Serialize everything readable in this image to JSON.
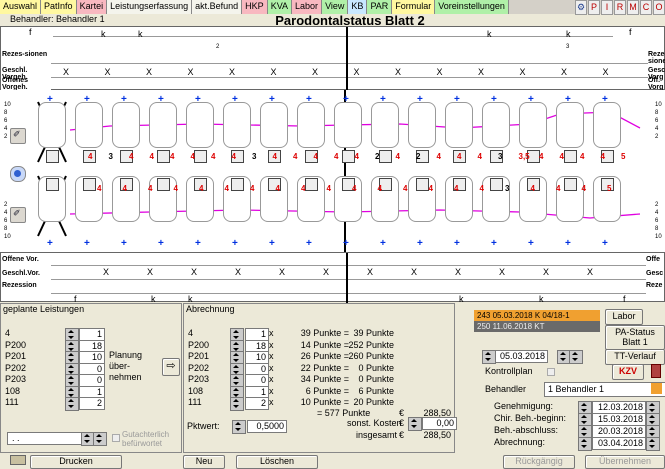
{
  "menu": {
    "tabs": [
      {
        "label": "Auswahl",
        "style": "cy"
      },
      {
        "label": "PatInfo",
        "style": "cy"
      },
      {
        "label": "Kartei",
        "style": "pk"
      },
      {
        "label": "Leistungserfassung",
        "style": "wh"
      },
      {
        "label": "akt.Befund",
        "style": "wh"
      },
      {
        "label": "HKP",
        "style": "pk"
      },
      {
        "label": "KVA",
        "style": "gr"
      },
      {
        "label": "Labor",
        "style": "pk"
      },
      {
        "label": "View",
        "style": "gr"
      },
      {
        "label": "KB",
        "style": "lb"
      },
      {
        "label": "PAR",
        "style": "gr"
      },
      {
        "label": "Formular",
        "style": "cy"
      },
      {
        "label": "Voreinstellungen",
        "style": "gr"
      }
    ],
    "icons": [
      "P",
      "I",
      "R",
      "M",
      "C",
      "O"
    ]
  },
  "header": {
    "behandler": "Behandler: Behandler 1",
    "title": "Parodontalstatus Blatt 2"
  },
  "upper_grid": {
    "row_f": "f",
    "labels": [
      "Rezes-sionen",
      "Geschl. Vorgeh.",
      "Offenes Vorgeh."
    ],
    "right_labels": [
      "Reze-sione",
      "Gesc Vorg",
      "Off. Vorg"
    ],
    "k_marks": [
      "k",
      "k",
      "k",
      "k"
    ],
    "small_nums": [
      "2",
      "3"
    ],
    "x_row": [
      "X",
      "X",
      "X",
      "X",
      "X",
      "X",
      "X",
      "X",
      "X",
      "X",
      "X",
      "X",
      "X",
      "X"
    ]
  },
  "teeth": {
    "upper_nums": [
      "4",
      "3",
      "4",
      "4",
      "4",
      "4",
      "4",
      "4",
      "3",
      "4",
      "4",
      "4",
      "4",
      "4",
      "2",
      "4",
      "2",
      "4",
      "4",
      "4",
      "3",
      "3,5",
      "4",
      "4",
      "4",
      "4",
      "5"
    ],
    "lower_nums": [
      "4",
      "4",
      "4",
      "4",
      "4",
      "4",
      "4",
      "4",
      "4",
      "4",
      "4",
      "4",
      "4",
      "4",
      "4",
      "4",
      "3",
      "4",
      "4",
      "4",
      "5"
    ],
    "scale_up": [
      "10",
      "8",
      "6",
      "4",
      "2"
    ],
    "scale_down": [
      "2",
      "4",
      "6",
      "8",
      "10"
    ]
  },
  "lower_grid": {
    "labels": [
      "Offene Vor.",
      "Geschl.Vor.",
      "Rezession"
    ],
    "right_labels": [
      "Offe",
      "Gesc",
      "Reze"
    ],
    "x_row": [
      "X",
      "X",
      "X",
      "X",
      "X",
      "X",
      "X",
      "X",
      "X",
      "X",
      "X",
      "X"
    ],
    "k_marks": [
      "k",
      "k",
      "k",
      "k"
    ],
    "row_f": "f"
  },
  "geplante": {
    "title": "geplante Leistungen",
    "rows": [
      {
        "code": "4",
        "val": "1"
      },
      {
        "code": "P200",
        "val": "18"
      },
      {
        "code": "P201",
        "val": "10"
      },
      {
        "code": "P202",
        "val": "0"
      },
      {
        "code": "P203",
        "val": "0"
      },
      {
        "code": "108",
        "val": "1"
      },
      {
        "code": "111",
        "val": "2"
      }
    ],
    "planung": "Planung über-nehmen",
    "date_placeholder": ".  .",
    "gutachterlich": "Gutachterlich befürwortet"
  },
  "abrechnung": {
    "title": "Abrechnung",
    "rows": [
      {
        "code": "4",
        "qty": "1",
        "punkte": "39 Punkte =",
        "total": "39 Punkte"
      },
      {
        "code": "P200",
        "qty": "18",
        "punkte": "14 Punkte =",
        "total": "252 Punkte"
      },
      {
        "code": "P201",
        "qty": "10",
        "punkte": "26 Punkte =",
        "total": "260 Punkte"
      },
      {
        "code": "P202",
        "qty": "0",
        "punkte": "22 Punkte =",
        "total": "0 Punkte"
      },
      {
        "code": "P203",
        "qty": "0",
        "punkte": "34 Punkte =",
        "total": "0 Punkte"
      },
      {
        "code": "108",
        "qty": "1",
        "punkte": "6 Punkte =",
        "total": "6 Punkte"
      },
      {
        "code": "111",
        "qty": "2",
        "punkte": "10 Punkte =",
        "total": "20 Punkte"
      }
    ],
    "x": "x",
    "sum": "= 577 Punkte",
    "euro": "€",
    "sum_euro": "288,50",
    "pktwert_label": "Pktwert:",
    "pktwert": "0,5000",
    "sonst_label": "sonst. Kosten",
    "sonst": "0,00",
    "insgesamt_label": "insgesamt",
    "insgesamt": "288,50"
  },
  "history": [
    {
      "text": "243 05.03.2018  K      04/18-1"
    },
    {
      "text": "250 11.06.2018  KT"
    }
  ],
  "right_panel": {
    "labor": "Labor",
    "pa_status": "PA-Status Blatt 1",
    "tt_verlauf": "TT-Verlauf",
    "kzv": "KZV",
    "date1": "05.03.2018",
    "kontrollplan": "Kontrollplan",
    "behandler_label": "Behandler",
    "behandler_value": "1 Behandler 1",
    "dates": [
      {
        "label": "Genehmigung:",
        "value": "12.03.2018"
      },
      {
        "label": "Chir. Beh.-beginn:",
        "value": "15.03.2018"
      },
      {
        "label": "Beh.-abschluss:",
        "value": "20.03.2018"
      },
      {
        "label": "Abrechnung:",
        "value": "03.04.2018"
      }
    ]
  },
  "bottom": {
    "drucken": "Drucken",
    "neu": "Neu",
    "loeschen": "Löschen",
    "rueckgaengig": "Rückgängig",
    "uebernehmen": "Übernehmen"
  },
  "colors": {
    "plus": "#0030e0",
    "pocket": "#e000e0",
    "red": "#d00000"
  }
}
